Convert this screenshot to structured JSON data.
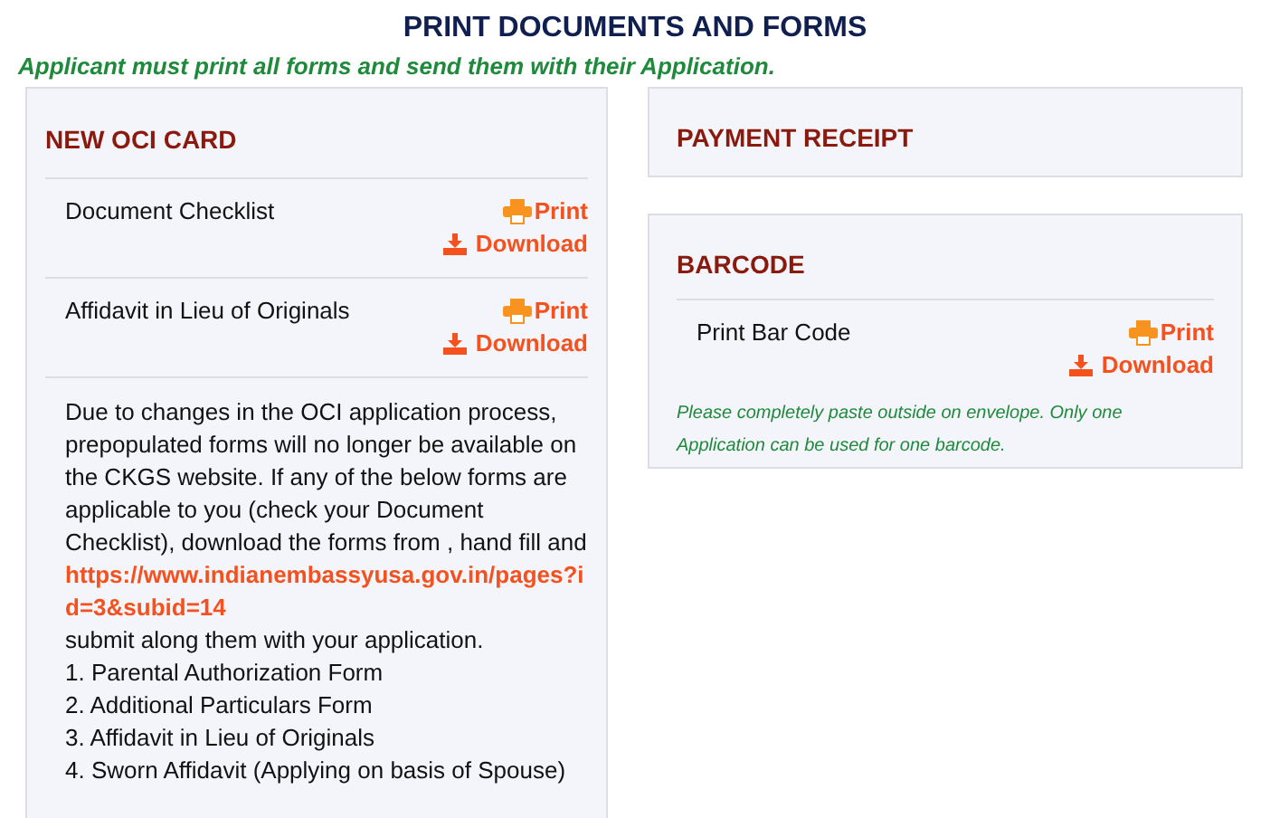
{
  "page_title": "PRINT DOCUMENTS AND FORMS",
  "notice": "Applicant must print all forms and send them with their Application.",
  "left_card": {
    "title": "NEW OCI CARD",
    "documents": [
      {
        "name": "Document Checklist",
        "print": "Print",
        "download": "Download"
      },
      {
        "name": "Affidavit in Lieu of Originals",
        "print": "Print",
        "download": "Download"
      }
    ],
    "info": {
      "text_before": "Due to changes in the OCI application process, prepopulated forms will no longer be available on the CKGS website. If any of the below forms are applicable to you (check your Document Checklist), download the forms from , hand fill and",
      "link": "https://www.indianembassyusa.gov.in/pages?id=3&subid=14",
      "text_after": "submit along them with your application.",
      "forms": [
        "1. Parental Authorization Form",
        "2. Additional Particulars Form",
        "3. Affidavit in Lieu of Originals",
        "4. Sworn Affidavit (Applying on basis of Spouse)"
      ]
    }
  },
  "payment_card": {
    "title": "PAYMENT RECEIPT"
  },
  "barcode_card": {
    "title": "BARCODE",
    "documents": [
      {
        "name": "Print Bar Code",
        "print": "Print",
        "download": "Download"
      }
    ],
    "note": "Please completely paste outside on envelope. Only one Application can be used for one barcode."
  }
}
